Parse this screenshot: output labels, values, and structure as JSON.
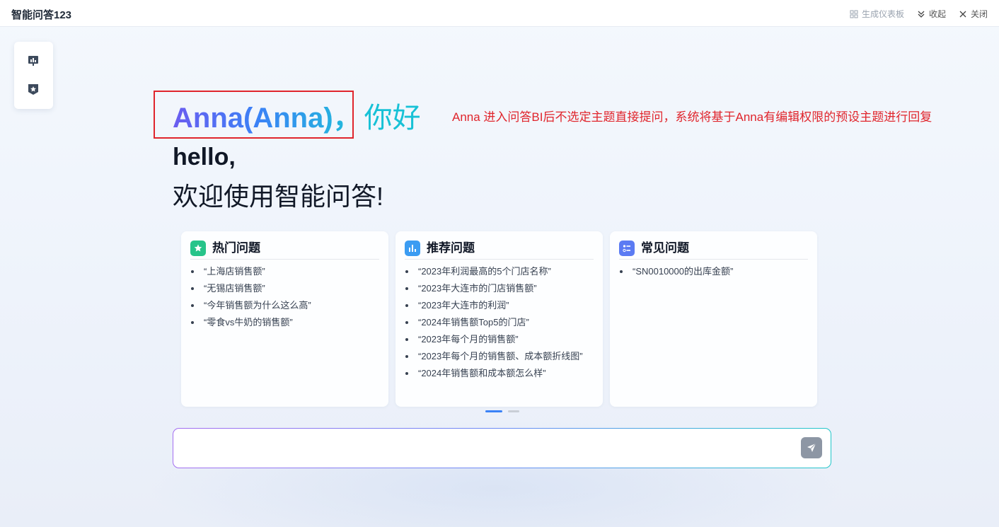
{
  "header": {
    "title": "智能问答123",
    "actions": {
      "dashboard": "生成仪表板",
      "collapse": "收起",
      "close": "关闭"
    }
  },
  "greeting": {
    "name": "Anna(Anna)，",
    "hi": "你好",
    "hello": "hello,",
    "welcome": "欢迎使用智能问答!"
  },
  "annotation": "Anna 进入问答BI后不选定主题直接提问，系统将基于Anna有编辑权限的预设主题进行回复",
  "cards": [
    {
      "title": "热门问题",
      "icon": "star-icon",
      "color": "#27c48a",
      "items": [
        "“上海店销售额”",
        "“无锡店销售额”",
        "“今年销售额为什么这么高”",
        "“零食vs牛奶的销售额”"
      ]
    },
    {
      "title": "推荐问题",
      "icon": "bar-chart-icon",
      "color": "#3b9cf2",
      "items": [
        "“2023年利润最高的5个门店名称”",
        "“2023年大连市的门店销售额”",
        "“2023年大连市的利润”",
        "“2024年销售额Top5的门店”",
        "“2023年每个月的销售额”",
        "“2023年每个月的销售额、成本额折线图”",
        "“2024年销售额和成本额怎么样”"
      ]
    },
    {
      "title": "常见问题",
      "icon": "list-icon",
      "color": "#5b7bf3",
      "items": [
        "“SN0010000的出库金额”"
      ]
    }
  ],
  "pagination": {
    "current": 1,
    "total": 2
  },
  "input": {
    "value": "",
    "placeholder": ""
  }
}
